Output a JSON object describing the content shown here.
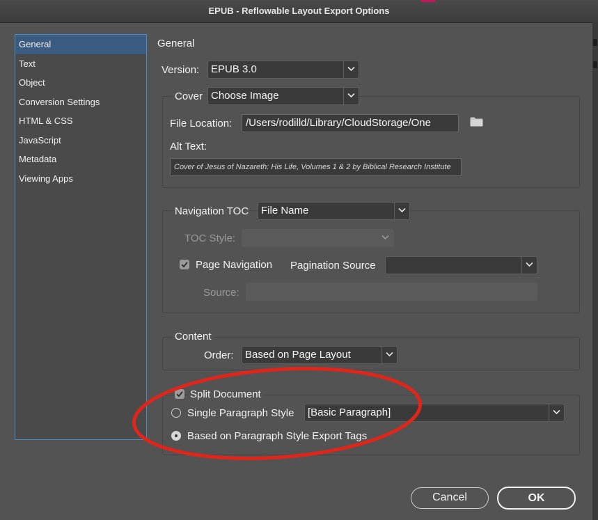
{
  "window": {
    "title": "EPUB - Reflowable Layout Export Options"
  },
  "sidebar": {
    "items": [
      {
        "label": "General",
        "selected": true
      },
      {
        "label": "Text"
      },
      {
        "label": "Object"
      },
      {
        "label": "Conversion Settings"
      },
      {
        "label": "HTML & CSS"
      },
      {
        "label": "JavaScript"
      },
      {
        "label": "Metadata"
      },
      {
        "label": "Viewing Apps"
      }
    ]
  },
  "general": {
    "heading": "General",
    "version": {
      "label": "Version:",
      "value": "EPUB 3.0"
    },
    "cover": {
      "label": "Cover",
      "value": "Choose Image",
      "file_location_label": "File Location:",
      "file_location_value": "/Users/rodilld/Library/CloudStorage/One",
      "folder_icon": "folder-icon",
      "alt_text_label": "Alt Text:",
      "alt_text_value": "Cover of Jesus of Nazareth: His Life, Volumes 1 & 2 by Biblical Research Institute"
    },
    "navigation": {
      "toc_label": "Navigation TOC",
      "toc_value": "File Name",
      "toc_style_label": "TOC Style:",
      "toc_style_value": "",
      "page_navigation_label": "Page Navigation",
      "page_navigation_checked": true,
      "pagination_source_label": "Pagination Source",
      "pagination_source_value": "",
      "source_label": "Source:",
      "source_value": ""
    },
    "content": {
      "heading": "Content",
      "order_label": "Order:",
      "order_value": "Based on Page Layout"
    },
    "split": {
      "split_document_label": "Split Document",
      "split_document_checked": true,
      "single_style_label": "Single Paragraph Style",
      "single_style_value": "[Basic Paragraph]",
      "single_style_selected": false,
      "export_tags_label": "Based on Paragraph Style Export Tags",
      "export_tags_selected": true
    }
  },
  "buttons": {
    "cancel": "Cancel",
    "ok": "OK"
  },
  "colors": {
    "annotation": "#e0261b",
    "selection": "#3b5c80",
    "focus_border": "#4a8ac6"
  }
}
